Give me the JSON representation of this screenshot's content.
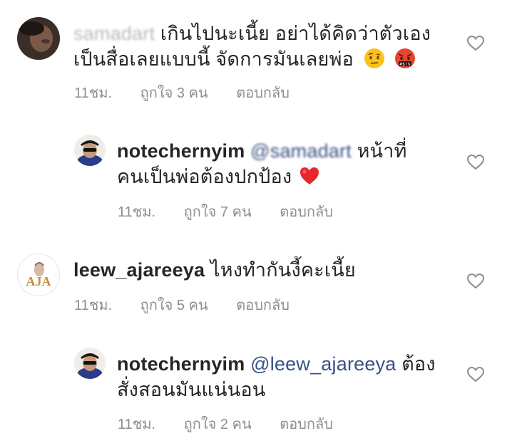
{
  "comments": [
    {
      "username": "samadart",
      "text_line1": "เกินไปนะเนี้ย อย่าได้คิดว่าตัวเอง",
      "text_line2": "เป็นสื่อเลยแบบนี้ จัดการมันเลยพ่อ",
      "emojis": [
        "face-with-raised-eyebrow-emoji",
        "face-with-symbols-on-mouth-emoji"
      ],
      "time": "11ชม.",
      "likes": "ถูกใจ 3 คน",
      "reply": "ตอบกลับ"
    },
    {
      "username": "notechernyim",
      "mention": "@samadart",
      "text_line1": "หน้าที่",
      "text_line2": "คนเป็นพ่อต้องปกป้อง",
      "emojis": [
        "red-heart-emoji"
      ],
      "time": "11ชม.",
      "likes": "ถูกใจ 7 คน",
      "reply": "ตอบกลับ"
    },
    {
      "username": "leew_ajareeya",
      "text_line1": "ไหงทำกันงี้คะเนี้ย",
      "avatar_text": "AJA",
      "time": "11ชม.",
      "likes": "ถูกใจ 5 คน",
      "reply": "ตอบกลับ"
    },
    {
      "username": "notechernyim",
      "mention": "@leew_ajareeya",
      "text_line1": "ต้อง",
      "text_line2": "สั่งสอนมันแน่นอน",
      "time": "11ชม.",
      "likes": "ถูกใจ 2 คน",
      "reply": "ตอบกลับ"
    }
  ],
  "colors": {
    "text": "#262626",
    "meta": "#8e8e8e",
    "mention": "#385185",
    "heart_outline": "#8e8e8e"
  }
}
